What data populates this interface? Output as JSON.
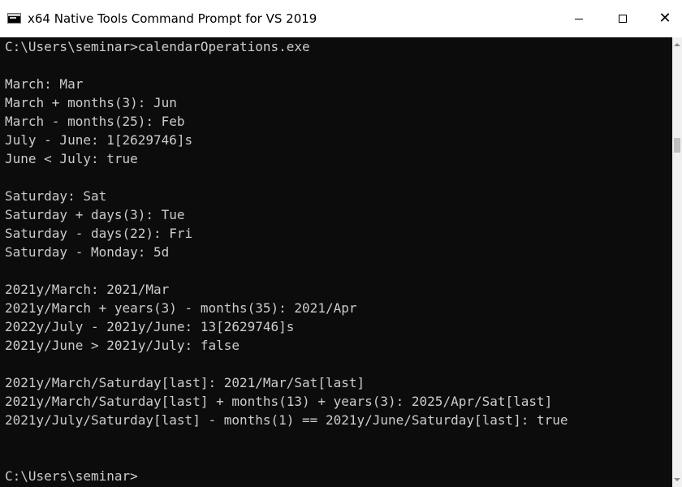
{
  "window": {
    "title": "x64 Native Tools Command Prompt for VS 2019",
    "icon": "console-icon",
    "controls": {
      "minimize_icon": "minimize-icon",
      "maximize_icon": "maximize-icon",
      "close_icon": "close-icon",
      "close_glyph": "✕"
    }
  },
  "console": {
    "background": "#0c0c0c",
    "foreground": "#cccccc",
    "lines": [
      "C:\\Users\\seminar>calendarOperations.exe",
      "",
      "March: Mar",
      "March + months(3): Jun",
      "March - months(25): Feb",
      "July - June: 1[2629746]s",
      "June < July: true",
      "",
      "Saturday: Sat",
      "Saturday + days(3): Tue",
      "Saturday - days(22): Fri",
      "Saturday - Monday: 5d",
      "",
      "2021y/March: 2021/Mar",
      "2021y/March + years(3) - months(35): 2021/Apr",
      "2022y/July - 2021y/June: 13[2629746]s",
      "2021y/June > 2021y/July: false",
      "",
      "2021y/March/Saturday[last]: 2021/Mar/Sat[last]",
      "2021y/March/Saturday[last] + months(13) + years(3): 2025/Apr/Sat[last]",
      "2021y/July/Saturday[last] - months(1) == 2021y/June/Saturday[last]: true",
      "",
      "",
      "C:\\Users\\seminar>"
    ]
  }
}
